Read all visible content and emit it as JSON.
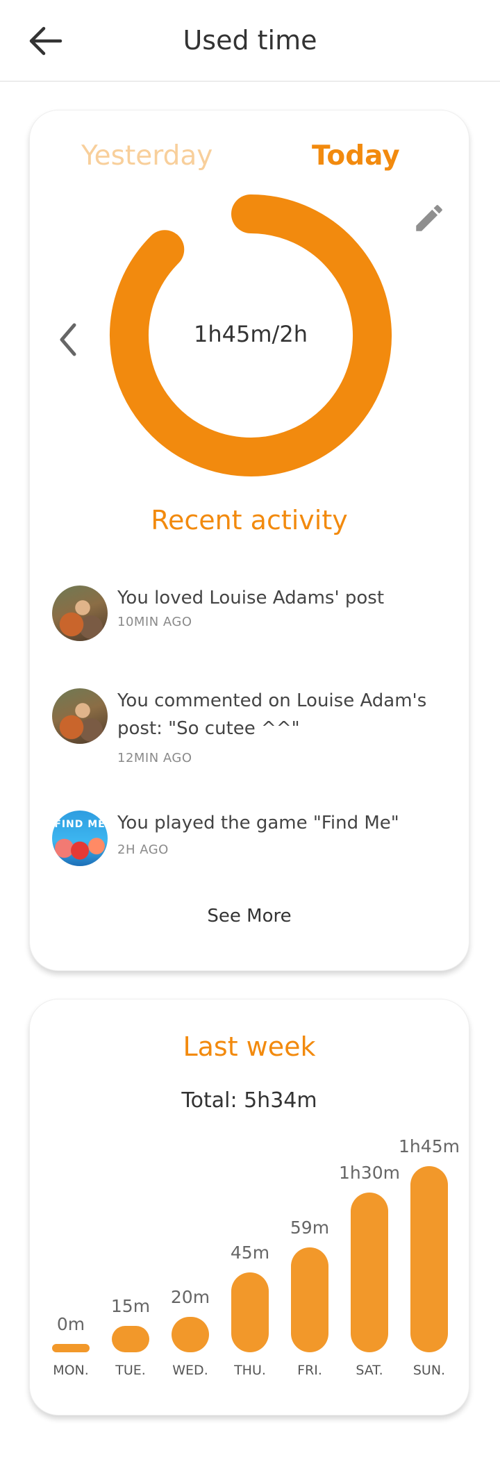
{
  "header": {
    "title": "Used time",
    "back_icon": "arrow-left-icon"
  },
  "usage": {
    "tabs": [
      {
        "label": "Yesterday",
        "active": false
      },
      {
        "label": "Today",
        "active": true
      }
    ],
    "progress_label": "1h45m/2h",
    "used_minutes": 105,
    "limit_minutes": 120,
    "accent_color": "#f28a0e",
    "edit_icon": "pencil-icon",
    "prev_icon": "chevron-left-icon"
  },
  "recent": {
    "title": "Recent activity",
    "items": [
      {
        "text": "You loved Louise Adams' post",
        "time": "10MIN AGO",
        "avatar": "photo"
      },
      {
        "text": "You commented on Louise Adam's post: \"So cutee ^^\"",
        "time": "12MIN AGO",
        "avatar": "photo"
      },
      {
        "text": "You played the game \"Find Me\"",
        "time": "2H AGO",
        "avatar": "game",
        "avatar_text": "FIND ME"
      }
    ],
    "see_more": "See More"
  },
  "week": {
    "title": "Last week",
    "total": "Total: 5h34m",
    "bar_color": "#f2982a"
  },
  "chart_data": {
    "type": "bar",
    "categories": [
      "MON.",
      "TUE.",
      "WED.",
      "THU.",
      "FRI.",
      "SAT.",
      "SUN."
    ],
    "values": [
      0,
      15,
      20,
      45,
      59,
      90,
      105
    ],
    "value_labels": [
      "0m",
      "15m",
      "20m",
      "45m",
      "59m",
      "1h30m",
      "1h45m"
    ],
    "title": "Last week",
    "ylabel": "",
    "xlabel": ""
  }
}
